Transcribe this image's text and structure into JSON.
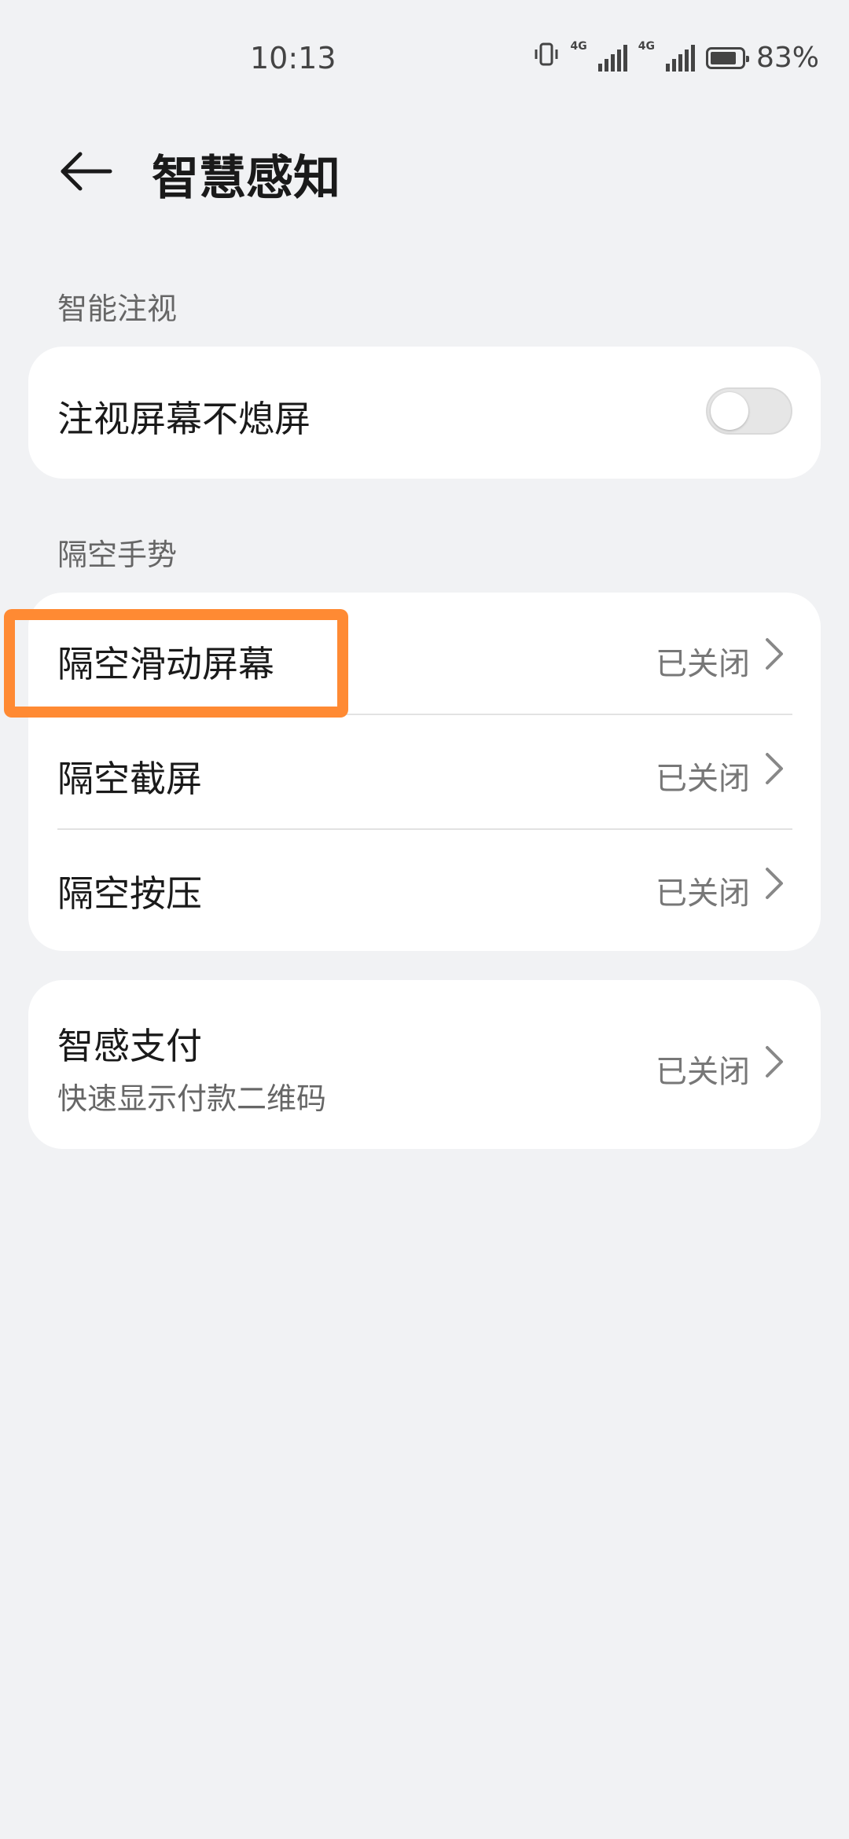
{
  "status_bar": {
    "time": "10:13",
    "network_1": "4G",
    "network_2": "4G",
    "battery_percent": "83%",
    "battery_level": 0.83,
    "icons": [
      "vibrate-icon",
      "signal-icon",
      "signal-icon",
      "battery-icon"
    ]
  },
  "header": {
    "back_icon": "back-arrow-icon",
    "title": "智慧感知"
  },
  "sections": {
    "smart_gaze": {
      "label": "智能注视",
      "items": [
        {
          "title": "注视屏幕不熄屏",
          "toggle_on": false
        }
      ]
    },
    "air_gesture": {
      "label": "隔空手势",
      "items": [
        {
          "title": "隔空滑动屏幕",
          "status": "已关闭"
        },
        {
          "title": "隔空截屏",
          "status": "已关闭"
        },
        {
          "title": "隔空按压",
          "status": "已关闭"
        }
      ]
    },
    "smart_pay": {
      "items": [
        {
          "title": "智感支付",
          "subtitle": "快速显示付款二维码",
          "status": "已关闭"
        }
      ]
    }
  },
  "colors": {
    "background": "#f1f2f4",
    "card": "#ffffff",
    "highlight": "#ff8a33"
  }
}
